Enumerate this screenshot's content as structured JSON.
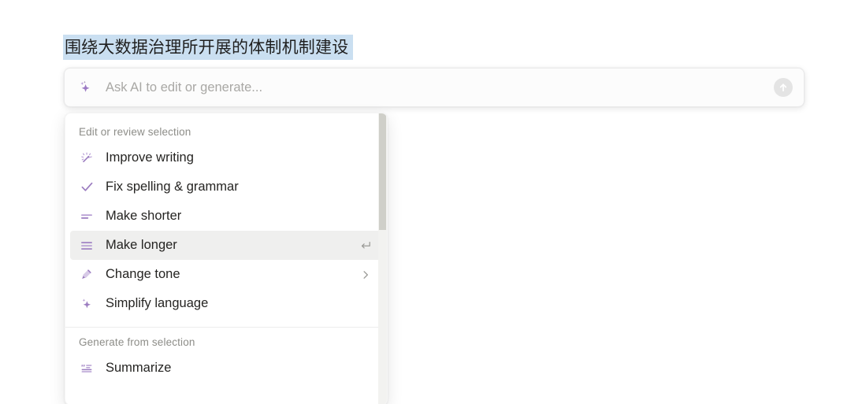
{
  "document": {
    "selected_text": "围绕大数据治理所开展的体制机制建设",
    "selection_highlight_color": "#cadff1"
  },
  "ai_bar": {
    "placeholder": "Ask AI to edit or generate...",
    "value": "",
    "leading_icon": "sparkle-icon",
    "submit_icon": "arrow-up-circle-icon",
    "accent_color": "#9c7ac4"
  },
  "menu": {
    "sections": [
      {
        "label": "Edit or review selection",
        "items": [
          {
            "label": "Improve writing",
            "icon": "magic-wand-icon",
            "active": false,
            "trailing": "",
            "trailing_icon": ""
          },
          {
            "label": "Fix spelling & grammar",
            "icon": "check-icon",
            "active": false,
            "trailing": "",
            "trailing_icon": ""
          },
          {
            "label": "Make shorter",
            "icon": "make-shorter-lines-icon",
            "active": false,
            "trailing": "",
            "trailing_icon": ""
          },
          {
            "label": "Make longer",
            "icon": "make-longer-lines-icon",
            "active": true,
            "trailing": "↵",
            "trailing_icon": "enter-return-icon"
          },
          {
            "label": "Change tone",
            "icon": "microphone-icon",
            "active": false,
            "trailing": "",
            "trailing_icon": "chevron-right-icon"
          },
          {
            "label": "Simplify language",
            "icon": "sparkle-icon",
            "active": false,
            "trailing": "",
            "trailing_icon": ""
          }
        ]
      },
      {
        "label": "Generate from selection",
        "items": [
          {
            "label": "Summarize",
            "icon": "quote-summary-icon",
            "active": false,
            "trailing": "",
            "trailing_icon": ""
          }
        ]
      }
    ],
    "icon_color": "#9b7cc0",
    "active_row_color": "#efefee",
    "scrollbar": {
      "track_color": "#f2f2f0",
      "thumb_color": "#cfcfc9"
    }
  }
}
